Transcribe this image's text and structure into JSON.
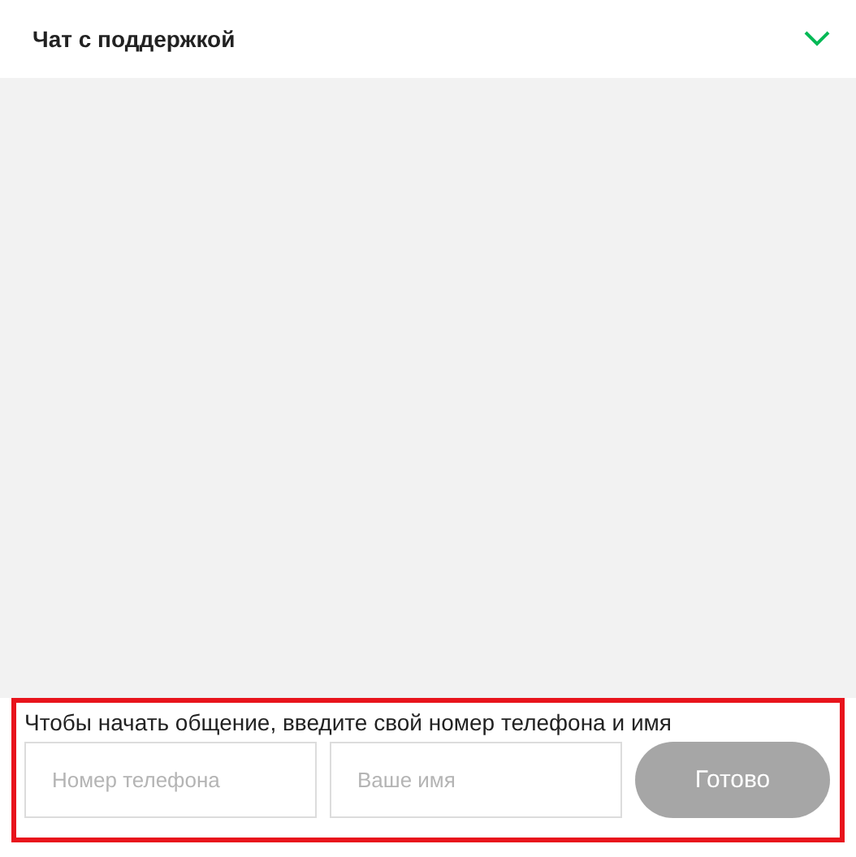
{
  "header": {
    "title": "Чат с поддержкой",
    "expanded": true
  },
  "form": {
    "prompt": "Чтобы начать общение, введите свой номер телефона и имя",
    "fields": [
      {
        "placeholder": "Номер телефона"
      },
      {
        "placeholder": "Ваше имя"
      }
    ],
    "submit": {
      "label": "Готово",
      "disabled": true
    }
  }
}
